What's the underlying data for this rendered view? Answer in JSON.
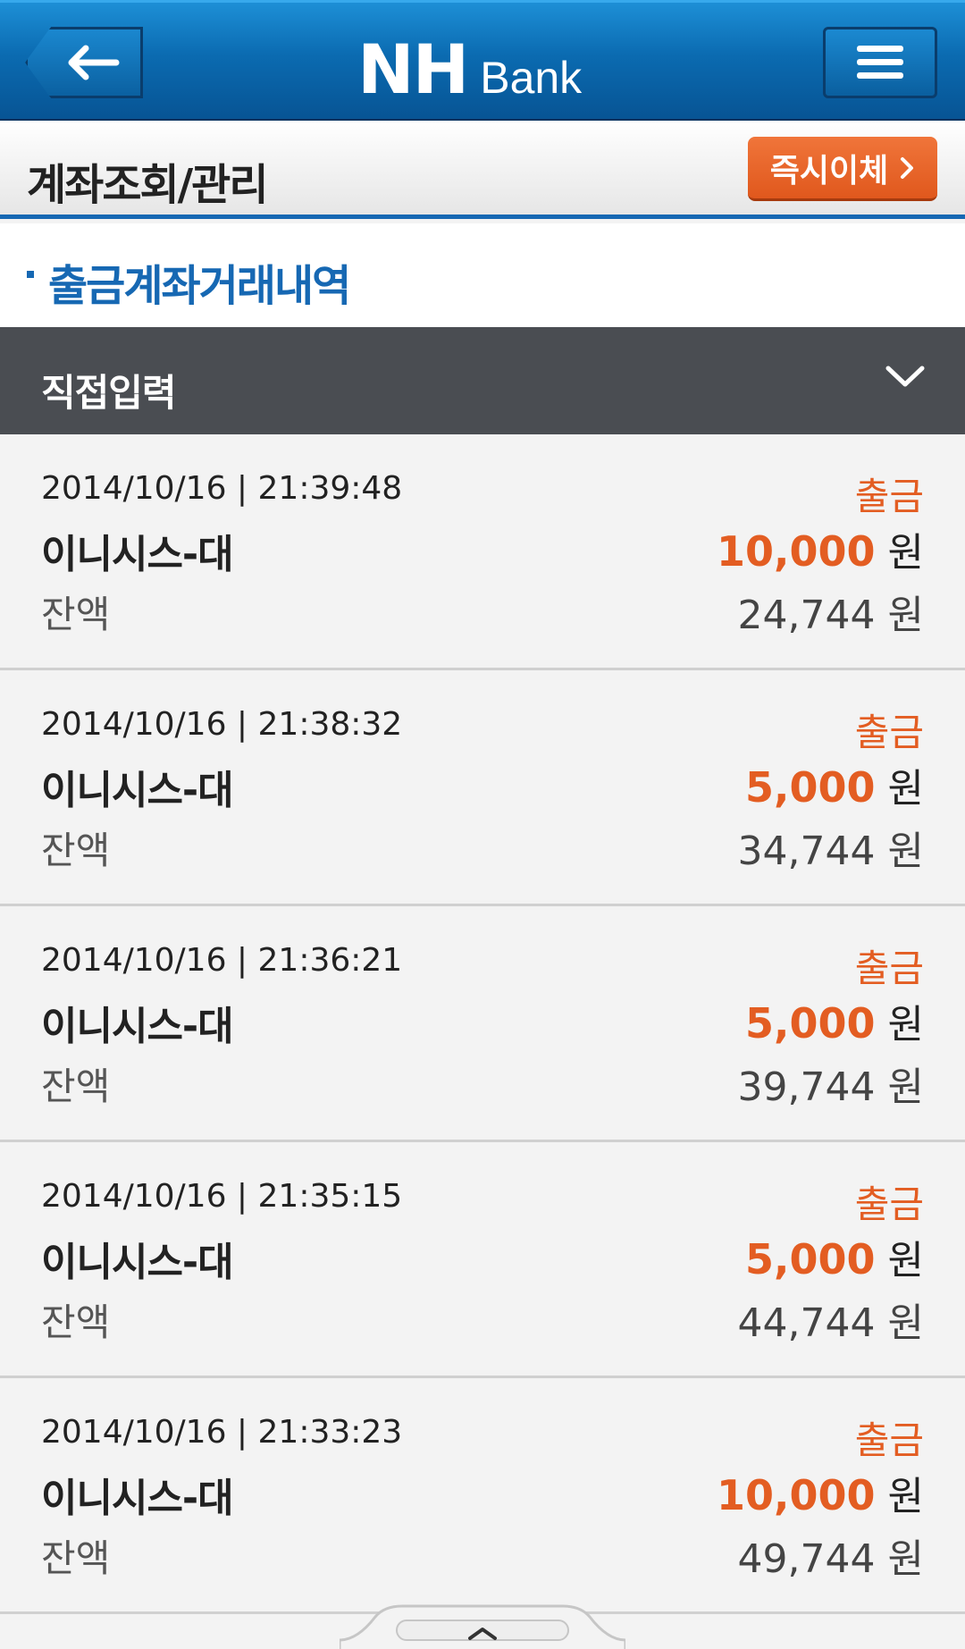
{
  "header": {
    "logo_mark": "NH",
    "logo_text": "Bank"
  },
  "subheader": {
    "title": "계좌조회/관리",
    "transfer_button": "즉시이체"
  },
  "section": {
    "title": "출금계좌거래내역"
  },
  "filter": {
    "label": "직접입력"
  },
  "transactions": [
    {
      "datetime": "2014/10/16 | 21:39:48",
      "name": "이니시스-대",
      "type": "출금",
      "amount": "10,000",
      "currency": "원",
      "balance_label": "잔액",
      "balance": "24,744",
      "balance_currency": "원"
    },
    {
      "datetime": "2014/10/16 | 21:38:32",
      "name": "이니시스-대",
      "type": "출금",
      "amount": "5,000",
      "currency": "원",
      "balance_label": "잔액",
      "balance": "34,744",
      "balance_currency": "원"
    },
    {
      "datetime": "2014/10/16 | 21:36:21",
      "name": "이니시스-대",
      "type": "출금",
      "amount": "5,000",
      "currency": "원",
      "balance_label": "잔액",
      "balance": "39,744",
      "balance_currency": "원"
    },
    {
      "datetime": "2014/10/16 | 21:35:15",
      "name": "이니시스-대",
      "type": "출금",
      "amount": "5,000",
      "currency": "원",
      "balance_label": "잔액",
      "balance": "44,744",
      "balance_currency": "원"
    },
    {
      "datetime": "2014/10/16 | 21:33:23",
      "name": "이니시스-대",
      "type": "출금",
      "amount": "10,000",
      "currency": "원",
      "balance_label": "잔액",
      "balance": "49,744",
      "balance_currency": "원"
    }
  ],
  "colors": {
    "header_blue": "#0b6bb1",
    "accent_orange": "#e35d22",
    "section_blue": "#1668b3",
    "filter_gray": "#4a4d52"
  },
  "icons": {
    "back": "arrow-left-icon",
    "menu": "hamburger-icon",
    "filter_toggle": "chevron-down-icon",
    "transfer": "chevron-right-icon",
    "bottom_handle": "chevron-up-icon"
  }
}
